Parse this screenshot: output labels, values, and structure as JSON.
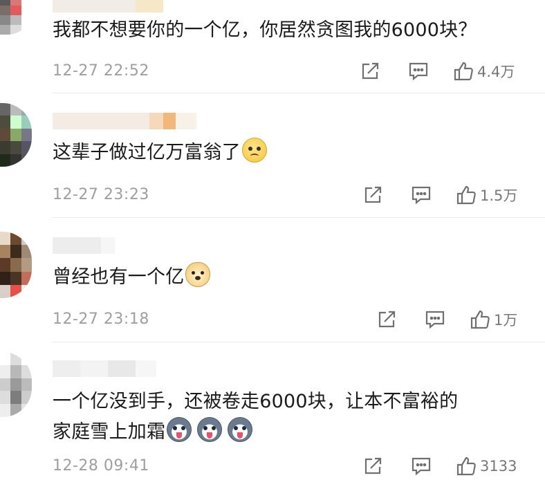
{
  "comments": [
    {
      "text": "我都不想要你的一个亿，你居然贪图我的6000块？",
      "time": "12-27 22:52",
      "likes": "4.4万",
      "emojis": [],
      "icons": [
        "share-icon",
        "reply-icon",
        "like-icon"
      ]
    },
    {
      "text": "这辈子做过亿万富翁了",
      "time": "12-27 23:23",
      "likes": "1.5万",
      "emojis": [
        "sad-emoji"
      ]
    },
    {
      "text": "曾经也有一个亿",
      "time": "12-27 23:18",
      "likes": "1万",
      "emojis": [
        "doge-emoji"
      ]
    },
    {
      "text": "一个亿没到手，还被卷走6000块，让本不富裕的",
      "text2": "家庭雪上加霜",
      "time": "12-28 09:41",
      "likes": "3133",
      "emojis": [
        "husky-emoji",
        "husky-emoji",
        "husky-emoji"
      ]
    }
  ]
}
